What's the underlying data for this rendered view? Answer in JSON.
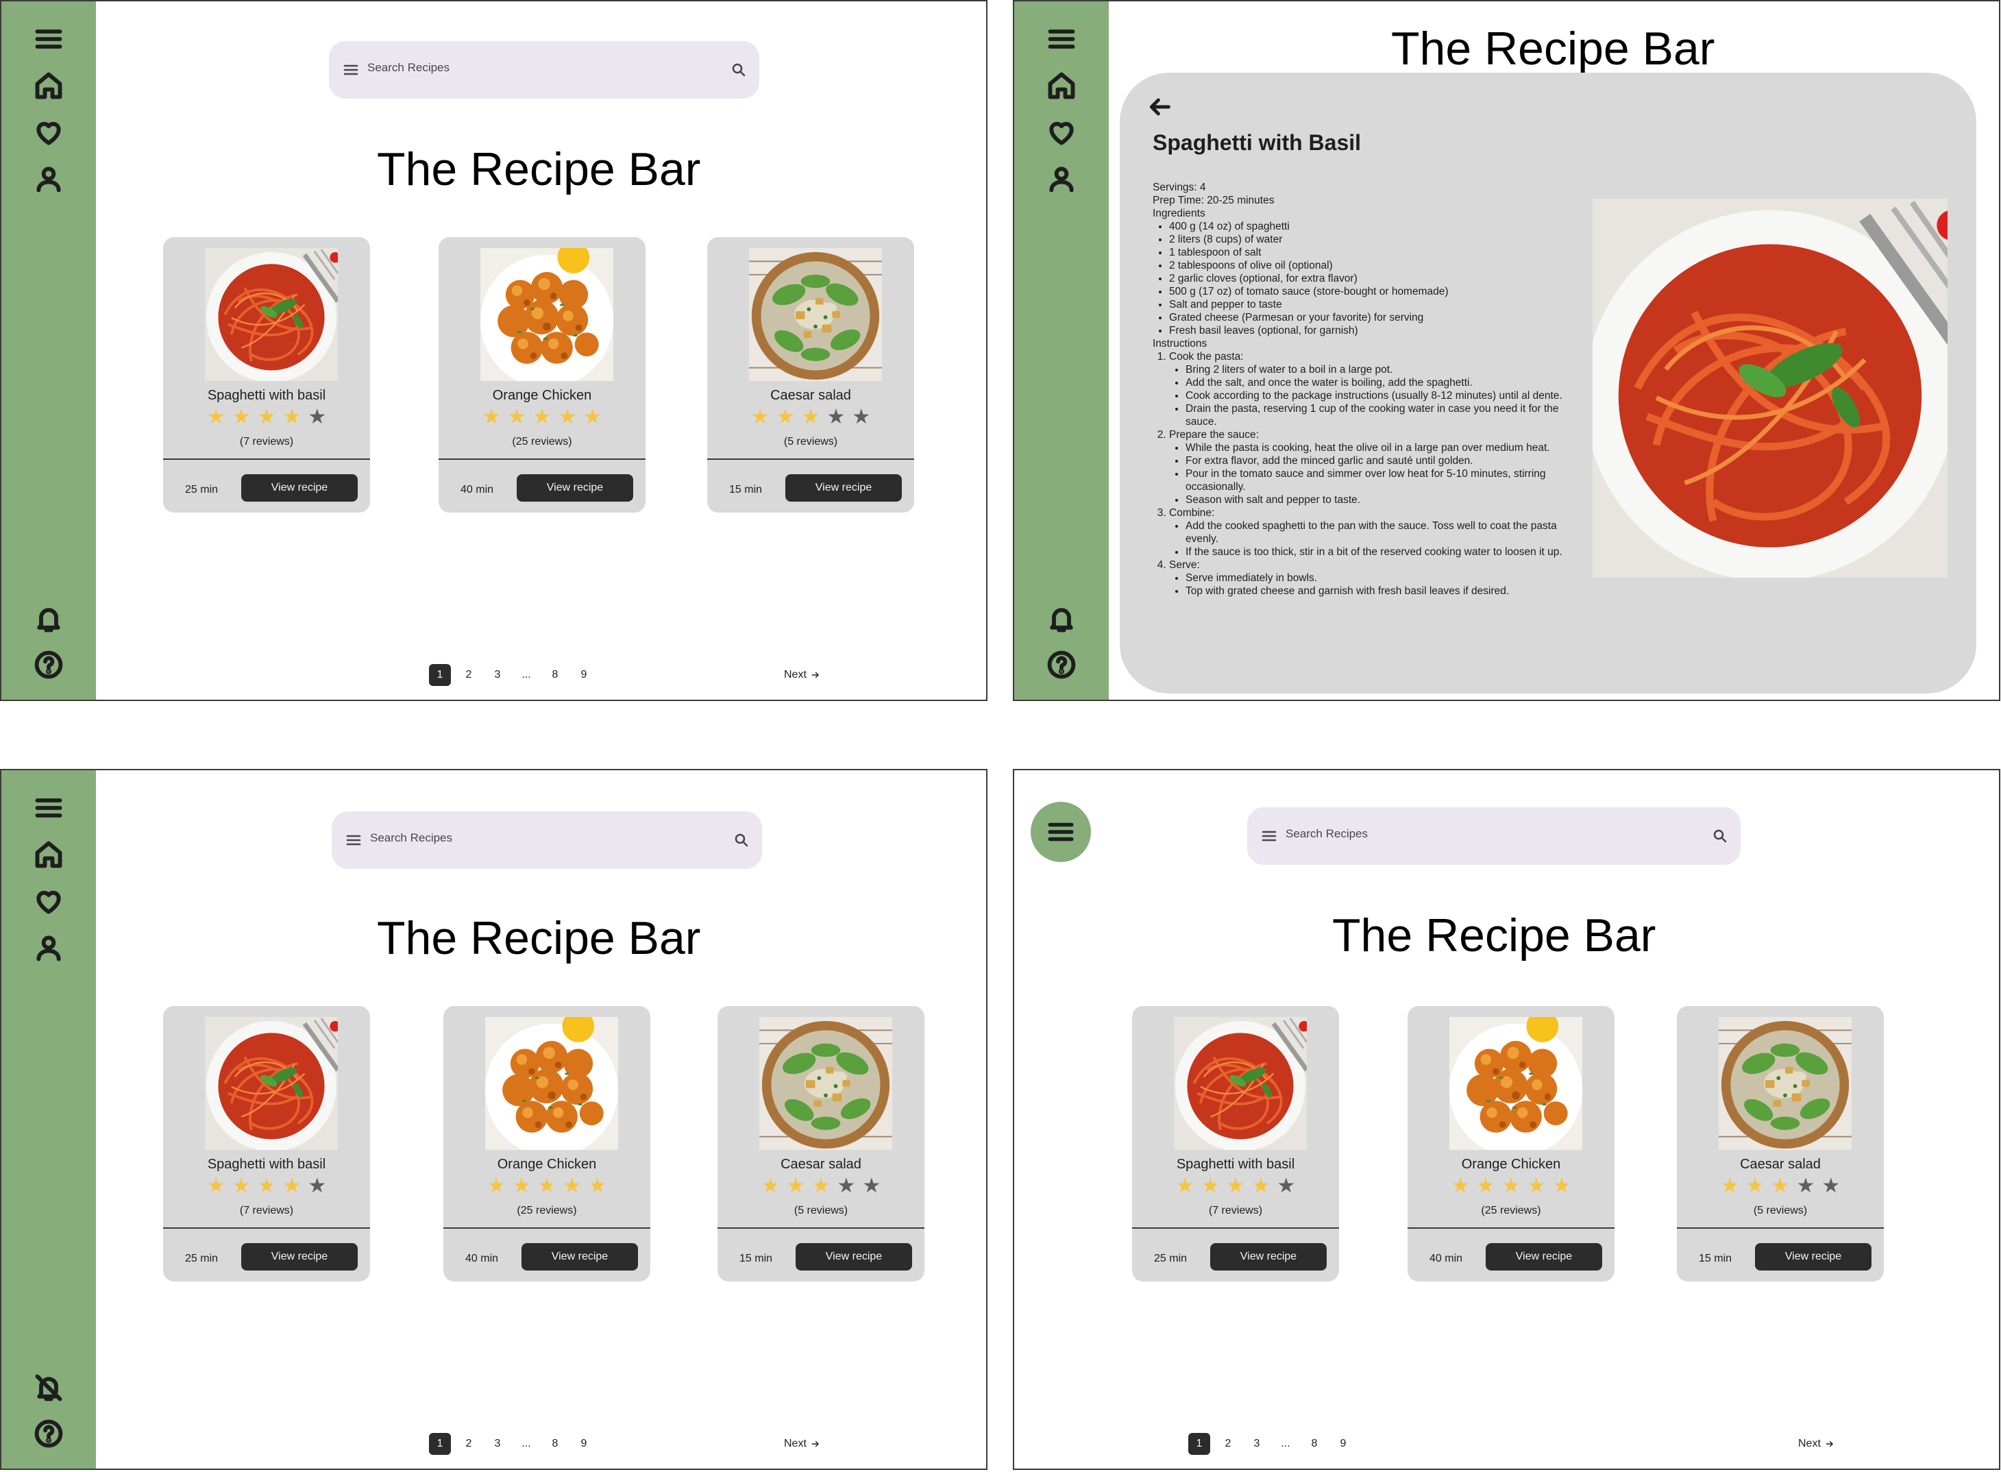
{
  "app": {
    "title": "The Recipe Bar"
  },
  "search": {
    "placeholder": "Search Recipes"
  },
  "nav": {
    "rail_icons": [
      "menu-icon",
      "home-icon",
      "heart-icon",
      "person-icon"
    ],
    "bottom_icons": [
      "bell-icon",
      "help-icon"
    ],
    "muted_bell_icon": "bell-off-icon"
  },
  "cards": [
    {
      "name": "Spaghetti with basil",
      "rating": 4,
      "max_rating": 5,
      "reviews": "(7 reviews)",
      "time": "25 min",
      "button": "View recipe",
      "image": "spaghetti-image"
    },
    {
      "name": "Orange Chicken",
      "rating": 5,
      "max_rating": 5,
      "reviews": "(25 reviews)",
      "time": "40 min",
      "button": "View recipe",
      "image": "orange-chicken-image"
    },
    {
      "name": "Caesar salad",
      "rating": 3,
      "max_rating": 5,
      "reviews": "(5 reviews)",
      "time": "15 min",
      "button": "View recipe",
      "image": "caesar-salad-image"
    }
  ],
  "pagination": {
    "pages": [
      "1",
      "2",
      "3",
      "...",
      "8",
      "9"
    ],
    "current": "1",
    "next": "Next"
  },
  "detail": {
    "title": "Spaghetti with Basil",
    "servings": "Servings: 4",
    "prep": "Prep Time: 20-25 minutes",
    "ingredients_heading": "Ingredients",
    "ingredients": [
      "400 g (14 oz) of spaghetti",
      "2 liters (8 cups) of water",
      "1 tablespoon of salt",
      "2 tablespoons of olive oil (optional)",
      "2 garlic cloves (optional, for extra flavor)",
      "500 g (17 oz) of tomato sauce (store-bought or homemade)",
      "Salt and pepper to taste",
      "Grated cheese (Parmesan or your favorite) for serving",
      "Fresh basil leaves (optional, for garnish)"
    ],
    "instructions_heading": "Instructions",
    "steps": [
      {
        "title": "Cook the pasta:",
        "items": [
          "Bring 2 liters of water to a boil in a large pot.",
          "Add the salt, and once the water is boiling, add the spaghetti.",
          "Cook according to the package instructions (usually 8-12 minutes) until al dente.",
          "Drain the pasta, reserving 1 cup of the cooking water in case you need it for the sauce."
        ]
      },
      {
        "title": "Prepare the sauce:",
        "items": [
          "While the pasta is cooking, heat the olive oil in a large pan over medium heat.",
          "For extra flavor, add the minced garlic and sauté until golden.",
          "Pour in the tomato sauce and simmer over low heat for 5-10 minutes, stirring occasionally.",
          "Season with salt and pepper to taste."
        ]
      },
      {
        "title": "Combine:",
        "items": [
          "Add the cooked spaghetti to the pan with the sauce. Toss well to coat the pasta evenly.",
          "If the sauce is too thick, stir in a bit of the reserved cooking water to loosen it up."
        ]
      },
      {
        "title": "Serve:",
        "items": [
          "Serve immediately in bowls.",
          "Top with grated cheese and garnish with fresh basil leaves if desired."
        ]
      }
    ]
  },
  "colors": {
    "rail": "#86ad7a",
    "card": "#d9d9d9",
    "search": "#ece6f0",
    "button": "#2c2c2c",
    "star_on": "#f5c542",
    "star_off": "#5f5f5f"
  }
}
